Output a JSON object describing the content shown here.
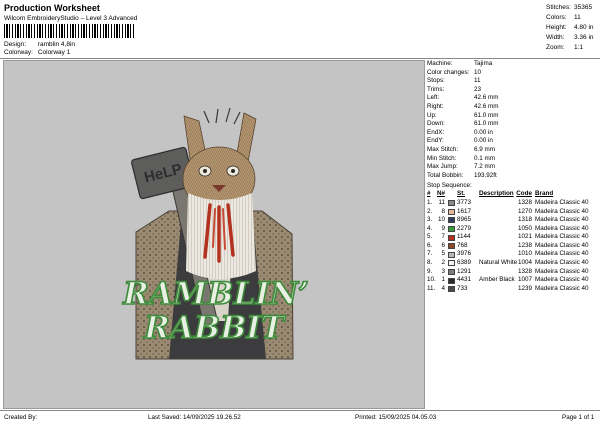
{
  "header": {
    "title": "Production Worksheet",
    "software": "Wilcom EmbroideryStudio – Level 3 Advanced",
    "design_label": "Design:",
    "design_value": "ramblin 4,8in",
    "colorway_label": "Colorway:",
    "colorway_value": "Colorway 1"
  },
  "top_stats": [
    {
      "label": "Stitches:",
      "value": "35365"
    },
    {
      "label": "Colors:",
      "value": "11"
    },
    {
      "label": "Height:",
      "value": "4.80 in"
    },
    {
      "label": "Width:",
      "value": "3.36 in"
    },
    {
      "label": "Zoom:",
      "value": "1:1"
    }
  ],
  "artwork": {
    "hammer_text": "HeLP",
    "line1": "RAMBLIN’",
    "line2": "RABBIT"
  },
  "properties": [
    {
      "label": "Machine:",
      "value": "Tajima"
    },
    {
      "label": "Color changes:",
      "value": "10"
    },
    {
      "label": "Stops:",
      "value": "11"
    },
    {
      "label": "Trims:",
      "value": "23"
    },
    {
      "label": "Left:",
      "value": "42.6 mm"
    },
    {
      "label": "Right:",
      "value": "42.6 mm"
    },
    {
      "label": "Up:",
      "value": "61.0 mm"
    },
    {
      "label": "Down:",
      "value": "61.0 mm"
    },
    {
      "label": "EndX:",
      "value": "0.00 in"
    },
    {
      "label": "EndY:",
      "value": "0.00 in"
    },
    {
      "label": "Max Stitch:",
      "value": "6.9 mm"
    },
    {
      "label": "Min Stitch:",
      "value": "0.1 mm"
    },
    {
      "label": "Max Jump:",
      "value": "7.2 mm"
    },
    {
      "label": "Total Bobbin:",
      "value": "193.92ft"
    }
  ],
  "stop_sequence": {
    "label": "Stop Sequence:",
    "headers": {
      "n": "#",
      "nn": "N#",
      "st": "St.",
      "desc": "Description",
      "code": "Code",
      "brand": "Brand"
    },
    "rows": [
      {
        "n": "1.",
        "nn": "11",
        "color": "#8a8a86",
        "st": "3773",
        "desc": "",
        "code": "1328",
        "brand": "Madeira Classic 40"
      },
      {
        "n": "2.",
        "nn": "8",
        "color": "#e8b79a",
        "st": "1617",
        "desc": "",
        "code": "1270",
        "brand": "Madeira Classic 40"
      },
      {
        "n": "3.",
        "nn": "10",
        "color": "#303d5c",
        "st": "8965",
        "desc": "",
        "code": "1318",
        "brand": "Madeira Classic 40"
      },
      {
        "n": "4.",
        "nn": "9",
        "color": "#3a9b3c",
        "st": "2279",
        "desc": "",
        "code": "1050",
        "brand": "Madeira Classic 40"
      },
      {
        "n": "5.",
        "nn": "7",
        "color": "#b3321f",
        "st": "1144",
        "desc": "",
        "code": "1021",
        "brand": "Madeira Classic 40"
      },
      {
        "n": "6.",
        "nn": "6",
        "color": "#8c4a2c",
        "st": "768",
        "desc": "",
        "code": "1238",
        "brand": "Madeira Classic 40"
      },
      {
        "n": "7.",
        "nn": "5",
        "color": "#b8b8b4",
        "st": "3976",
        "desc": "",
        "code": "1010",
        "brand": "Madeira Classic 40"
      },
      {
        "n": "8.",
        "nn": "2",
        "color": "#f4f4f0",
        "st": "6389",
        "desc": "Natural White",
        "code": "1004",
        "brand": "Madeira Classic 40"
      },
      {
        "n": "9.",
        "nn": "3",
        "color": "#7e7a74",
        "st": "1291",
        "desc": "",
        "code": "1328",
        "brand": "Madeira Classic 40"
      },
      {
        "n": "10.",
        "nn": "1",
        "color": "#2a2a2a",
        "st": "4431",
        "desc": "Amber Black",
        "code": "1007",
        "brand": "Madeira Classic 40"
      },
      {
        "n": "11.",
        "nn": "4",
        "color": "#4a4a4a",
        "st": "733",
        "desc": "",
        "code": "1239",
        "brand": "Madeira Classic 40"
      }
    ]
  },
  "footer": {
    "created_by": "Created By:",
    "last_saved": "Last Saved: 14/09/2025 19.26.52",
    "printed": "Printed: 15/09/2025 04.05.03",
    "page": "Page 1 of 1"
  }
}
